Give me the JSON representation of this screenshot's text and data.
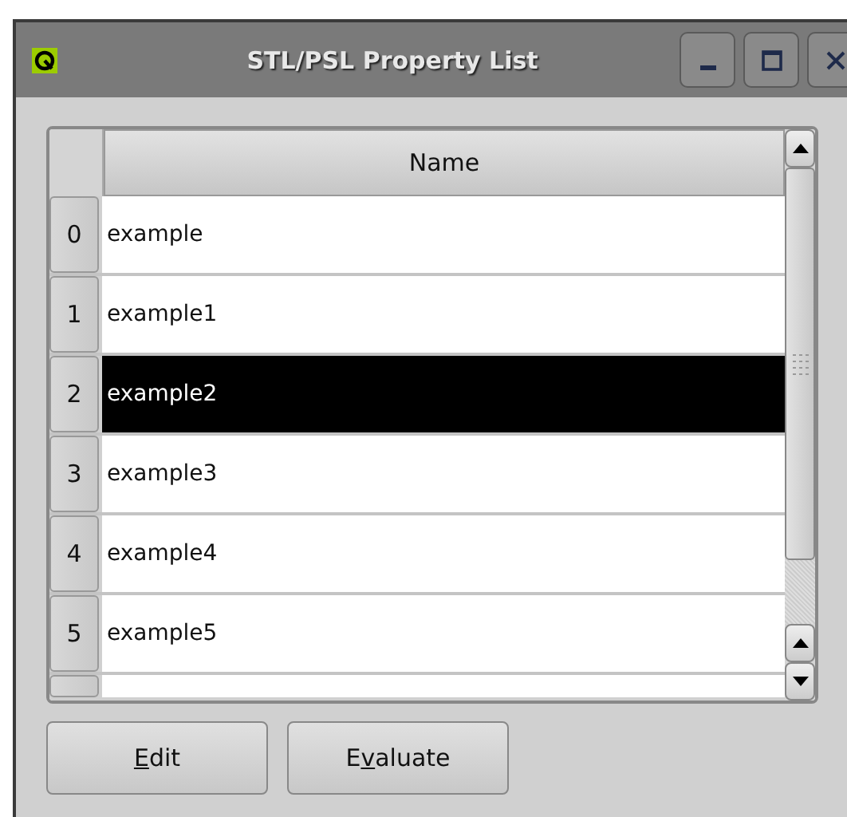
{
  "window": {
    "title": "STL/PSL Property List"
  },
  "table": {
    "columns": [
      "Name"
    ],
    "rows": [
      {
        "number": "0",
        "name": "example",
        "selected": false
      },
      {
        "number": "1",
        "name": "example1",
        "selected": false
      },
      {
        "number": "2",
        "name": "example2",
        "selected": true
      },
      {
        "number": "3",
        "name": "example3",
        "selected": false
      },
      {
        "number": "4",
        "name": "example4",
        "selected": false
      },
      {
        "number": "5",
        "name": "example5",
        "selected": false
      }
    ]
  },
  "buttons": [
    {
      "parts": [
        {
          "text": "E",
          "underlined": true
        },
        {
          "text": "dit",
          "underlined": false
        }
      ]
    },
    {
      "parts": [
        {
          "text": "E",
          "underlined": false
        },
        {
          "text": "v",
          "underlined": true
        },
        {
          "text": "aluate",
          "underlined": false
        }
      ]
    }
  ]
}
